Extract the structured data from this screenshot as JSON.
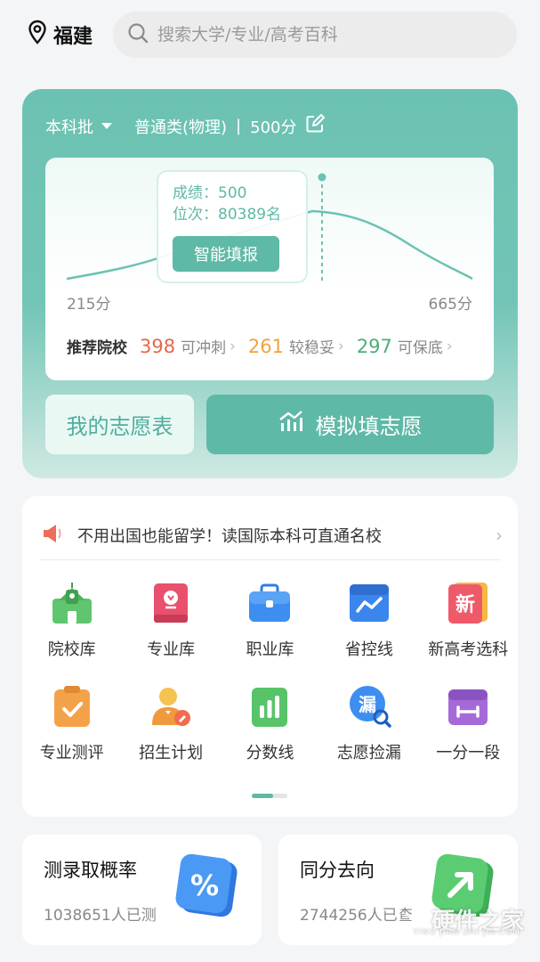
{
  "location": {
    "icon": "location-pin-icon",
    "city": "福建"
  },
  "search": {
    "placeholder": "搜索大学/专业/高考百科",
    "icon": "search-icon"
  },
  "hero": {
    "batch": "本科批",
    "subject": "普通类(物理)",
    "separator": "|",
    "score_label": "500分",
    "tooltip": {
      "score_line": "成绩：500",
      "rank_line": "位次：80389名",
      "button": "智能填报"
    },
    "axis_min": "215分",
    "axis_max": "665分",
    "recommend_label": "推荐院校",
    "recommend": [
      {
        "count": "398",
        "text": "可冲刺",
        "color": "#e8674a"
      },
      {
        "count": "261",
        "text": "较稳妥",
        "color": "#f0a143"
      },
      {
        "count": "297",
        "text": "可保底",
        "color": "#4cae78"
      }
    ],
    "btn_my": "我的志愿表",
    "btn_sim": "模拟填志愿",
    "accent": "#5fb9a7"
  },
  "notice": {
    "text": "不用出国也能留学！读国际本科可直通名校",
    "icon": "speaker-icon"
  },
  "tools": [
    {
      "label": "院校库",
      "icon": "school-icon"
    },
    {
      "label": "专业库",
      "icon": "book-icon"
    },
    {
      "label": "职业库",
      "icon": "briefcase-icon"
    },
    {
      "label": "省控线",
      "icon": "line-chart-icon"
    },
    {
      "label": "新高考选科",
      "icon": "new-exam-icon"
    },
    {
      "label": "专业测评",
      "icon": "clipboard-check-icon"
    },
    {
      "label": "招生计划",
      "icon": "recruiter-icon"
    },
    {
      "label": "分数线",
      "icon": "bar-chart-icon"
    },
    {
      "label": "志愿捡漏",
      "icon": "magnifier-icon"
    },
    {
      "label": "一分一段",
      "icon": "segment-icon"
    }
  ],
  "cards": [
    {
      "title": "测录取概率",
      "sub": "1038651人已测",
      "icon": "percent-icon"
    },
    {
      "title": "同分去向",
      "sub": "2744256人已查",
      "icon": "arrow-up-right-icon"
    }
  ],
  "watermark": {
    "title": "硬件之家",
    "sub": "YING JIAN ZHI JIA.COM"
  }
}
